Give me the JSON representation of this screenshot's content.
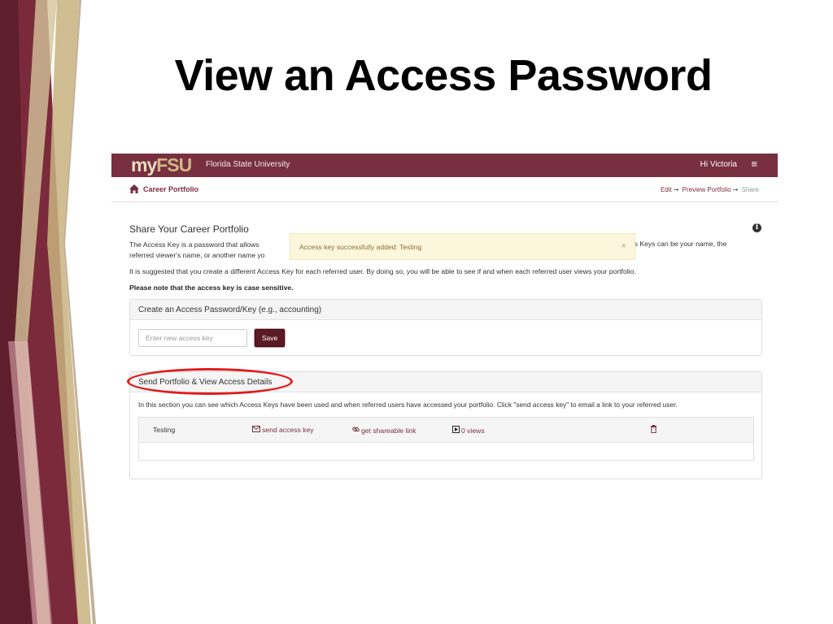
{
  "slide": {
    "title": "View an Access Password"
  },
  "header": {
    "brand_my": "my",
    "brand_fsu": "FSU",
    "university": "Florida State University",
    "greeting": "Hi Victoria",
    "menu_icon": "hamburger-menu-icon"
  },
  "breadcrumb": {
    "home_icon": "home-icon",
    "label": "Career Portfolio",
    "steps": [
      "Edit",
      "Preview Portfolio",
      "Share"
    ],
    "step_arrow": "➞"
  },
  "share": {
    "heading": "Share Your Career Portfolio",
    "info_icon": "i",
    "para1_left": "The Access Key is a password that allows",
    "para1_left_line2": "referred viewer's name, or another name yo",
    "para1_right": "ccess Keys can be your name, the",
    "para2": "It is suggested that you create a different Access Key for each referred user. By doing so, you will be able to see if and when each referred user views your portfolio.",
    "para3": "Please note that the access key is case sensitive."
  },
  "toast": {
    "message": "Access key successfully added: Testing",
    "close": "×"
  },
  "create_panel": {
    "title": "Create an Access Password/Key (e.g., accounting)",
    "placeholder": "Enter new access key",
    "save_label": "Save"
  },
  "send_panel": {
    "title": "Send Portfolio & View Access Details",
    "description": "In this section you can see which Access Keys have been used and when referred users have accessed your portfolio. Click \"send access key\" to email a link to your referred user.",
    "rows": [
      {
        "name": "Testing",
        "send_label": "send access key",
        "link_label": "get shareable link",
        "views_label": "0 views"
      }
    ]
  },
  "colors": {
    "garnet": "#782f40",
    "gold": "#ceb888",
    "highlight": "#e11b1b"
  }
}
